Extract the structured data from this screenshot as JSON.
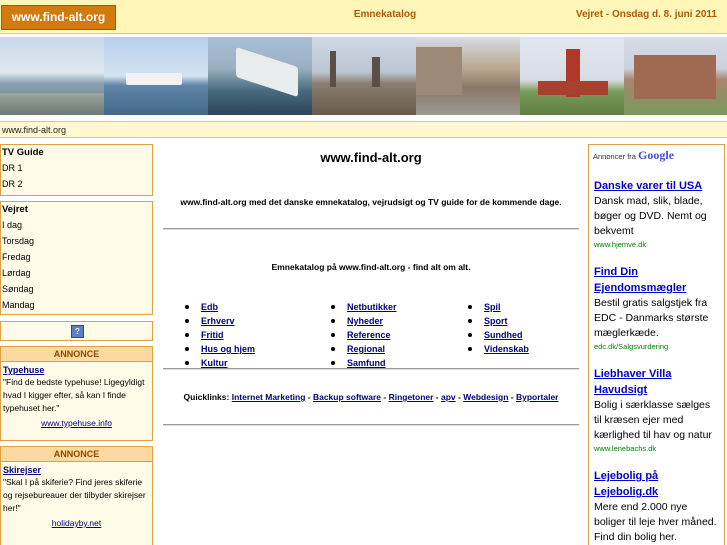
{
  "header": {
    "logo": "www.find-alt.org",
    "center_link": "Emnekatalog",
    "weather_date": "Vejret - Onsdag d. 8. juni 2011"
  },
  "url_bar": "www.find-alt.org",
  "tv_guide": {
    "title": "TV Guide",
    "items": [
      "DR 1",
      "DR 2"
    ]
  },
  "weather": {
    "title": "Vejret",
    "items": [
      "I dag",
      "Torsdag",
      "Fredag",
      "Lørdag",
      "Søndag",
      "Mandag"
    ]
  },
  "help_icon_glyph": "?",
  "ads_left": [
    {
      "header": "ANNONCE",
      "title": "Typehuse",
      "text": "\"Find de bedste typehuse! Ligegyldigt hvad I kigger efter, så kan I finde typehuset her.\"",
      "link": "www.typehuse.info"
    },
    {
      "header": "ANNONCE",
      "title": "Skirejser",
      "text": "\"Skal I på skiferie? Find jeres skiferie og rejsebureauer der tilbyder skirejser her!\"",
      "link": "holidayby.net"
    }
  ],
  "main": {
    "title": "www.find-alt.org",
    "intro": "www.find-alt.org med det danske emnekatalog, vejrudsigt og TV guide for de kommende dage.",
    "catalog_title": "Emnekatalog på www.find-alt.org - find alt om alt.",
    "categories": [
      [
        "Edb",
        "Erhverv",
        "Fritid",
        "Hus og hjem",
        "Kultur"
      ],
      [
        "Netbutikker",
        "Nyheder",
        "Reference",
        "Regional",
        "Samfund"
      ],
      [
        "Spil",
        "Sport",
        "Sundhed",
        "Videnskab"
      ]
    ],
    "quicklinks_label": "Quicklinks:",
    "quicklinks": [
      "Internet Marketing",
      "Backup software",
      "Ringetoner",
      "apv",
      "Webdesign",
      "Byportaler"
    ]
  },
  "google_ads": {
    "label_prefix": "Annoncer fra",
    "label_brand": "Google",
    "ads": [
      {
        "title": "Danske varer til USA",
        "desc": "Dansk mad, slik, blade, bøger og DVD. Nemt og bekvemt",
        "url": "www.hjemve.dk"
      },
      {
        "title": "Find Din Ejendomsmægler",
        "desc": "Bestil gratis salgstjek fra EDC - Danmarks største mæglerkæde.",
        "url": "edc.dk/Salgsvurdering"
      },
      {
        "title": "Liebhaver Villa Havudsigt",
        "desc": "Bolig i særklasse sælges til kræsen ejer med kærlighed til hav og natur",
        "url": "www.lenebachs.dk"
      },
      {
        "title": "Lejebolig på Lejebolig.dk",
        "desc": "Mere end 2.000 nye boliger til leje hver måned. Find din bolig her.",
        "url": ""
      }
    ]
  },
  "colors": {
    "header_bg": "#fff6b8",
    "logo_bg": "#d07a10",
    "accent_text": "#b05a00",
    "box_border": "#e0a040",
    "ad_header_bg": "#fcd9a0",
    "link": "#000080",
    "google_link": "#0000cc",
    "google_url": "#008000"
  }
}
